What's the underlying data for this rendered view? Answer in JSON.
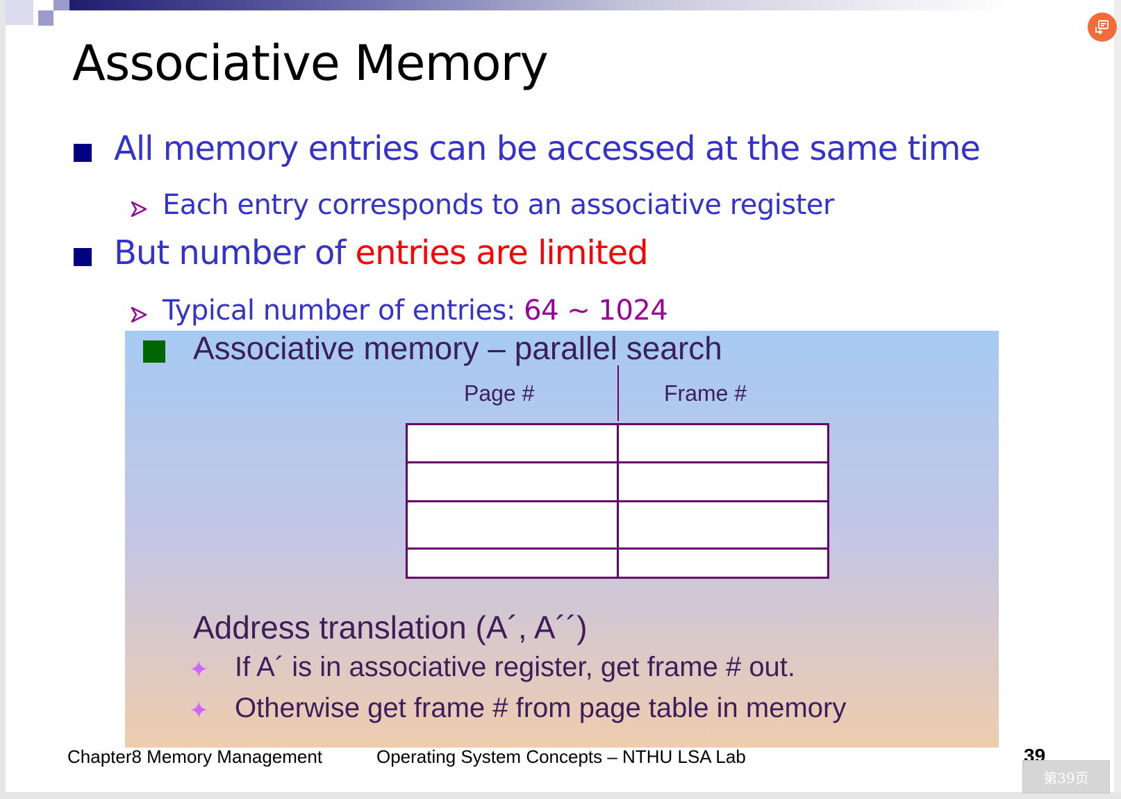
{
  "slide": {
    "title": "Associative Memory",
    "bullets": [
      {
        "text": "All memory entries can be accessed at the same time",
        "sub": "Each entry corresponds to  an associative register"
      },
      {
        "text_pre": "But number of ",
        "text_em": "entries are limited",
        "sub_pre": "Typical number of entries: ",
        "sub_em": "64 ~ 1024"
      }
    ],
    "figure": {
      "heading": "Associative memory – parallel search",
      "col_page": "Page #",
      "col_frame": "Frame #",
      "rows": 4,
      "addr_title": "Address translation (A´, A´´)",
      "addr_items": [
        "If A´ is in associative register, get frame # out.",
        "Otherwise get frame # from page table in memory"
      ]
    },
    "footer": {
      "left": "Chapter8 Memory Management",
      "center": "Operating System Concepts – NTHU LSA Lab",
      "page_number": "39"
    }
  },
  "viewer": {
    "page_badge": "第39页"
  },
  "colors": {
    "title": "#000000",
    "bullet_text": "#3333CC",
    "bullet_marker": "#000080",
    "emphasis_red": "#FF0000",
    "emphasis_purple": "#990099",
    "sub_arrow": "#990099",
    "figure_heading": "#3C1E5A",
    "figure_bullet": "#006600",
    "table_border": "#660066",
    "star": "#CC66FF",
    "gradient_top": "#A6CAF3",
    "gradient_bottom": "#EFCCAE",
    "corner_button": "#F26B3A"
  }
}
